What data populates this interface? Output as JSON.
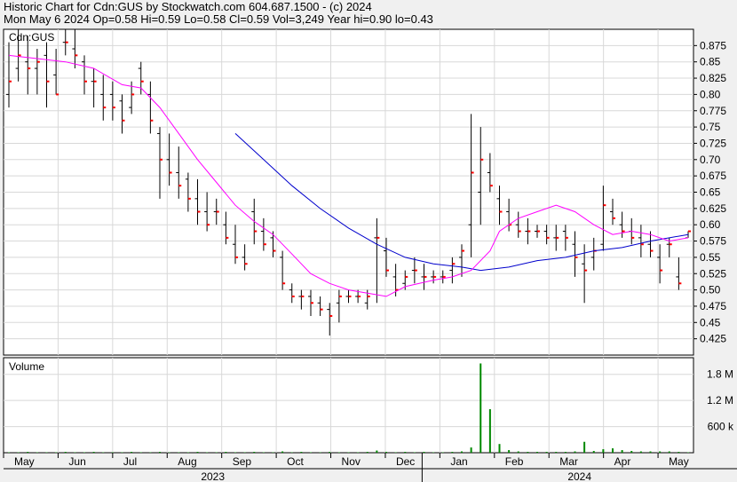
{
  "header": {
    "line1": "Historic Chart for Cdn:GUS by Stockwatch.com 604.687.1500 - (c) 2024",
    "line2": "Mon May  6 2024  Op=0.58  Hi=0.59  Lo=0.58  Cl=0.59  Vol=3,249  Year hi=0.90  lo=0.43"
  },
  "chart_data": [
    {
      "type": "line",
      "panel": "price",
      "label": "Cdn:GUS",
      "ylim": [
        0.4,
        0.9
      ],
      "y_ticks": [
        "0.875",
        "0.85",
        "0.825",
        "0.80",
        "0.775",
        "0.75",
        "0.725",
        "0.70",
        "0.675",
        "0.65",
        "0.625",
        "0.60",
        "0.575",
        "0.55",
        "0.525",
        "0.50",
        "0.475",
        "0.45",
        "0.425"
      ],
      "x_months": [
        "May",
        "Jun",
        "Jul",
        "Aug",
        "Sep",
        "Oct",
        "Nov",
        "Dec",
        "Jan",
        "Feb",
        "Mar",
        "Apr",
        "May"
      ],
      "x_years": [
        "2023",
        "2024"
      ],
      "colors": {
        "bars": "#000000",
        "close": "#ff0000",
        "ma_short": "#ff00ff",
        "ma_long": "#0000cc"
      },
      "ohlc": [
        [
          0.8,
          0.88,
          0.78,
          0.82
        ],
        [
          0.84,
          0.9,
          0.82,
          0.86
        ],
        [
          0.85,
          0.89,
          0.8,
          0.84
        ],
        [
          0.84,
          0.87,
          0.8,
          0.85
        ],
        [
          0.86,
          0.88,
          0.78,
          0.82
        ],
        [
          0.83,
          0.87,
          0.8,
          0.8
        ],
        [
          0.88,
          0.9,
          0.86,
          0.88
        ],
        [
          0.87,
          0.9,
          0.84,
          0.86
        ],
        [
          0.85,
          0.86,
          0.8,
          0.82
        ],
        [
          0.82,
          0.84,
          0.78,
          0.82
        ],
        [
          0.8,
          0.83,
          0.76,
          0.78
        ],
        [
          0.8,
          0.82,
          0.76,
          0.78
        ],
        [
          0.79,
          0.8,
          0.74,
          0.76
        ],
        [
          0.78,
          0.82,
          0.77,
          0.8
        ],
        [
          0.84,
          0.85,
          0.8,
          0.82
        ],
        [
          0.8,
          0.82,
          0.74,
          0.76
        ],
        [
          0.74,
          0.75,
          0.64,
          0.7
        ],
        [
          0.7,
          0.74,
          0.66,
          0.68
        ],
        [
          0.68,
          0.72,
          0.64,
          0.66
        ],
        [
          0.67,
          0.68,
          0.62,
          0.64
        ],
        [
          0.64,
          0.67,
          0.6,
          0.62
        ],
        [
          0.62,
          0.65,
          0.59,
          0.6
        ],
        [
          0.62,
          0.64,
          0.6,
          0.62
        ],
        [
          0.6,
          0.62,
          0.57,
          0.58
        ],
        [
          0.57,
          0.6,
          0.54,
          0.55
        ],
        [
          0.55,
          0.57,
          0.53,
          0.54
        ],
        [
          0.62,
          0.64,
          0.57,
          0.59
        ],
        [
          0.59,
          0.61,
          0.56,
          0.57
        ],
        [
          0.58,
          0.59,
          0.55,
          0.56
        ],
        [
          0.55,
          0.56,
          0.5,
          0.51
        ],
        [
          0.5,
          0.51,
          0.48,
          0.49
        ],
        [
          0.49,
          0.5,
          0.47,
          0.49
        ],
        [
          0.49,
          0.5,
          0.46,
          0.48
        ],
        [
          0.48,
          0.49,
          0.46,
          0.47
        ],
        [
          0.47,
          0.48,
          0.43,
          0.46
        ],
        [
          0.48,
          0.5,
          0.45,
          0.49
        ],
        [
          0.49,
          0.5,
          0.48,
          0.49
        ],
        [
          0.49,
          0.5,
          0.48,
          0.49
        ],
        [
          0.48,
          0.5,
          0.47,
          0.49
        ],
        [
          0.58,
          0.61,
          0.48,
          0.58
        ],
        [
          0.56,
          0.58,
          0.52,
          0.53
        ],
        [
          0.52,
          0.54,
          0.49,
          0.5
        ],
        [
          0.51,
          0.53,
          0.5,
          0.52
        ],
        [
          0.53,
          0.55,
          0.51,
          0.53
        ],
        [
          0.52,
          0.54,
          0.5,
          0.52
        ],
        [
          0.52,
          0.53,
          0.51,
          0.52
        ],
        [
          0.52,
          0.53,
          0.51,
          0.52
        ],
        [
          0.53,
          0.55,
          0.51,
          0.54
        ],
        [
          0.55,
          0.57,
          0.52,
          0.56
        ],
        [
          0.6,
          0.77,
          0.55,
          0.68
        ],
        [
          0.65,
          0.75,
          0.6,
          0.7
        ],
        [
          0.68,
          0.71,
          0.65,
          0.66
        ],
        [
          0.64,
          0.66,
          0.6,
          0.62
        ],
        [
          0.62,
          0.64,
          0.59,
          0.6
        ],
        [
          0.6,
          0.62,
          0.58,
          0.59
        ],
        [
          0.59,
          0.61,
          0.57,
          0.59
        ],
        [
          0.59,
          0.6,
          0.58,
          0.59
        ],
        [
          0.59,
          0.6,
          0.57,
          0.58
        ],
        [
          0.58,
          0.6,
          0.56,
          0.58
        ],
        [
          0.59,
          0.6,
          0.56,
          0.58
        ],
        [
          0.57,
          0.59,
          0.52,
          0.55
        ],
        [
          0.54,
          0.57,
          0.48,
          0.53
        ],
        [
          0.55,
          0.58,
          0.53,
          0.56
        ],
        [
          0.57,
          0.66,
          0.56,
          0.63
        ],
        [
          0.62,
          0.64,
          0.6,
          0.61
        ],
        [
          0.6,
          0.62,
          0.58,
          0.59
        ],
        [
          0.59,
          0.61,
          0.57,
          0.58
        ],
        [
          0.58,
          0.6,
          0.55,
          0.57
        ],
        [
          0.57,
          0.59,
          0.55,
          0.56
        ],
        [
          0.55,
          0.57,
          0.51,
          0.53
        ],
        [
          0.57,
          0.58,
          0.55,
          0.57
        ],
        [
          0.52,
          0.55,
          0.5,
          0.51
        ],
        [
          0.58,
          0.59,
          0.58,
          0.59
        ]
      ],
      "ma_short": [
        [
          0,
          0.86
        ],
        [
          3,
          0.855
        ],
        [
          6,
          0.85
        ],
        [
          9,
          0.84
        ],
        [
          12,
          0.815
        ],
        [
          14,
          0.81
        ],
        [
          16,
          0.78
        ],
        [
          18,
          0.74
        ],
        [
          20,
          0.7
        ],
        [
          22,
          0.665
        ],
        [
          24,
          0.63
        ],
        [
          26,
          0.605
        ],
        [
          28,
          0.585
        ],
        [
          30,
          0.555
        ],
        [
          32,
          0.525
        ],
        [
          34,
          0.51
        ],
        [
          36,
          0.5
        ],
        [
          38,
          0.495
        ],
        [
          40,
          0.49
        ],
        [
          42,
          0.505
        ],
        [
          45,
          0.515
        ],
        [
          47,
          0.52
        ],
        [
          49,
          0.53
        ],
        [
          51,
          0.56
        ],
        [
          52,
          0.59
        ],
        [
          54,
          0.61
        ],
        [
          56,
          0.62
        ],
        [
          58,
          0.63
        ],
        [
          60,
          0.62
        ],
        [
          62,
          0.6
        ],
        [
          64,
          0.585
        ],
        [
          66,
          0.59
        ],
        [
          68,
          0.585
        ],
        [
          70,
          0.575
        ],
        [
          72,
          0.58
        ]
      ],
      "ma_long": [
        [
          24,
          0.74
        ],
        [
          27,
          0.7
        ],
        [
          30,
          0.66
        ],
        [
          33,
          0.625
        ],
        [
          36,
          0.595
        ],
        [
          39,
          0.57
        ],
        [
          42,
          0.55
        ],
        [
          45,
          0.54
        ],
        [
          48,
          0.535
        ],
        [
          50,
          0.53
        ],
        [
          53,
          0.535
        ],
        [
          56,
          0.545
        ],
        [
          59,
          0.55
        ],
        [
          62,
          0.56
        ],
        [
          65,
          0.565
        ],
        [
          68,
          0.575
        ],
        [
          70,
          0.58
        ],
        [
          72,
          0.585
        ]
      ]
    },
    {
      "type": "bar",
      "panel": "volume",
      "label": "Volume",
      "ylim": [
        0,
        2.1
      ],
      "y_ticks": [
        "1.8 M",
        "1.2 M",
        "600 k"
      ],
      "color": "#008800",
      "values": [
        0.01,
        0.01,
        0.02,
        0.01,
        0.01,
        0.01,
        0.02,
        0.01,
        0.01,
        0.02,
        0.01,
        0.01,
        0.01,
        0.02,
        0.01,
        0.01,
        0.02,
        0.01,
        0.01,
        0.01,
        0.02,
        0.01,
        0.01,
        0.02,
        0.01,
        0.01,
        0.02,
        0.01,
        0.01,
        0.03,
        0.01,
        0.02,
        0.01,
        0.01,
        0.02,
        0.01,
        0.01,
        0.01,
        0.02,
        0.05,
        0.02,
        0.01,
        0.02,
        0.01,
        0.02,
        0.01,
        0.01,
        0.02,
        0.03,
        0.12,
        2.05,
        1.0,
        0.2,
        0.06,
        0.03,
        0.02,
        0.02,
        0.02,
        0.02,
        0.02,
        0.03,
        0.25,
        0.04,
        0.08,
        0.1,
        0.06,
        0.04,
        0.03,
        0.03,
        0.03,
        0.03,
        0.02,
        0.01
      ]
    }
  ]
}
